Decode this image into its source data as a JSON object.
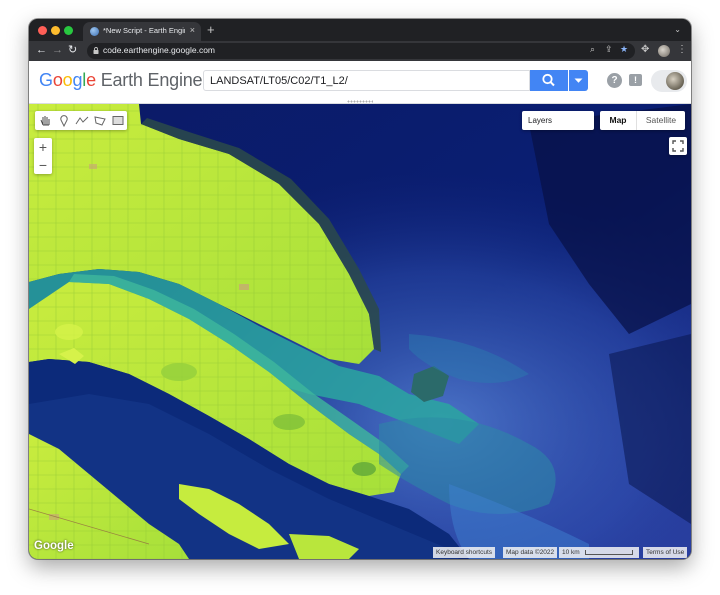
{
  "browser": {
    "tab_title": "*New Script - Earth Engine Co",
    "tab_close": "×",
    "new_tab": "+",
    "url": "code.earthengine.google.com"
  },
  "app": {
    "logo_google": [
      "G",
      "o",
      "o",
      "g",
      "l",
      "e"
    ],
    "logo_product": "Earth Engine",
    "search_value": "LANDSAT/LT05/C02/T1_L2/",
    "help_label": "?",
    "feedback_label": "!"
  },
  "map": {
    "layers_label": "Layers",
    "map_type_options": [
      "Map",
      "Satellite"
    ],
    "selected_map_type": "Map",
    "zoom_in": "+",
    "zoom_out": "−",
    "google_logo": "Google",
    "attribution": {
      "shortcuts": "Keyboard shortcuts",
      "map_data": "Map data ©2022",
      "scale": "10 km",
      "terms": "Terms of Use"
    }
  },
  "colors": {
    "accent": "#4285f4",
    "land": "#b8e83a",
    "water_deep": "#06124f",
    "water_turbid": "#2a9d9a"
  }
}
